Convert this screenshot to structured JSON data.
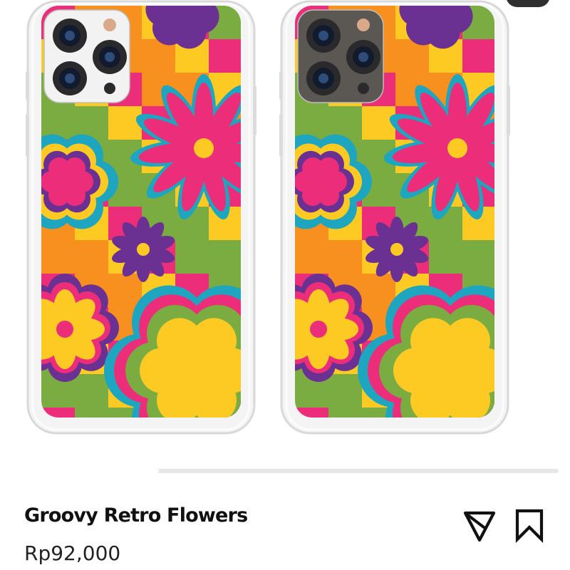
{
  "gallery": {
    "images": [
      {
        "label": "phone case image (silver iPhone)",
        "camera_color": "#f2f2f2"
      },
      {
        "label": "phone case image (graphite iPhone)",
        "camera_color": "#5b5752"
      }
    ],
    "scroll_progress": 0.27
  },
  "product": {
    "title": "Groovy Retro Flowers",
    "price": "Rp92,000"
  },
  "actions": {
    "share_icon": "send-icon",
    "save_icon": "bookmark-icon"
  },
  "colors": {
    "pink": "#ec2d7a",
    "green": "#7aac42",
    "orange": "#f7901e",
    "yellow": "#fcca22",
    "purple": "#6a3192",
    "teal": "#1ea5bf"
  }
}
